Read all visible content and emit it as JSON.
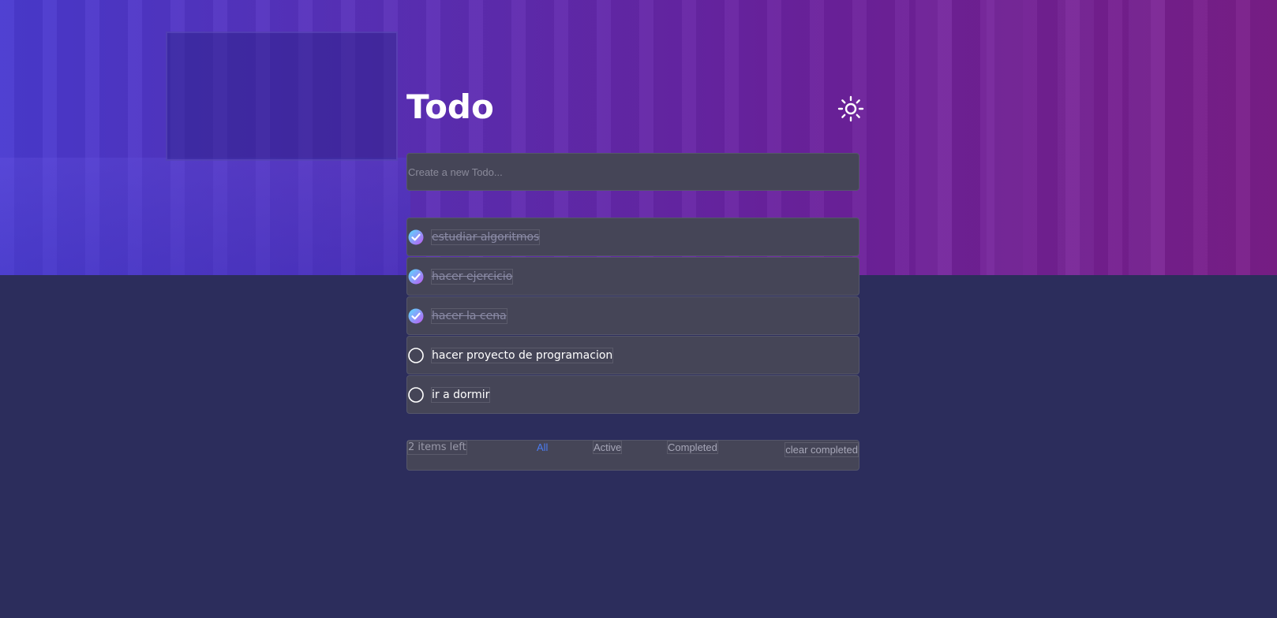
{
  "header": {
    "title": "Todo",
    "theme_icon": "sun-icon"
  },
  "new_todo": {
    "placeholder": "Create a new Todo..."
  },
  "todos": [
    {
      "text": "estudiar algoritmos",
      "completed": true
    },
    {
      "text": "hacer ejercicio",
      "completed": true
    },
    {
      "text": "hacer la cena",
      "completed": true
    },
    {
      "text": "hacer proyecto de programacion",
      "completed": false
    },
    {
      "text": "ir a dormir",
      "completed": false
    }
  ],
  "footer": {
    "items_left": "2 items left",
    "filters": [
      "All",
      "Active",
      "Completed"
    ],
    "active_filter": "All",
    "clear_label": "clear completed"
  },
  "colors": {
    "accent_active_filter": "#4b7cf2",
    "checked_gradient_start": "#57ddff",
    "checked_gradient_end": "#c058f3",
    "card_background": "#454557",
    "page_background": "#2c2d5c"
  }
}
